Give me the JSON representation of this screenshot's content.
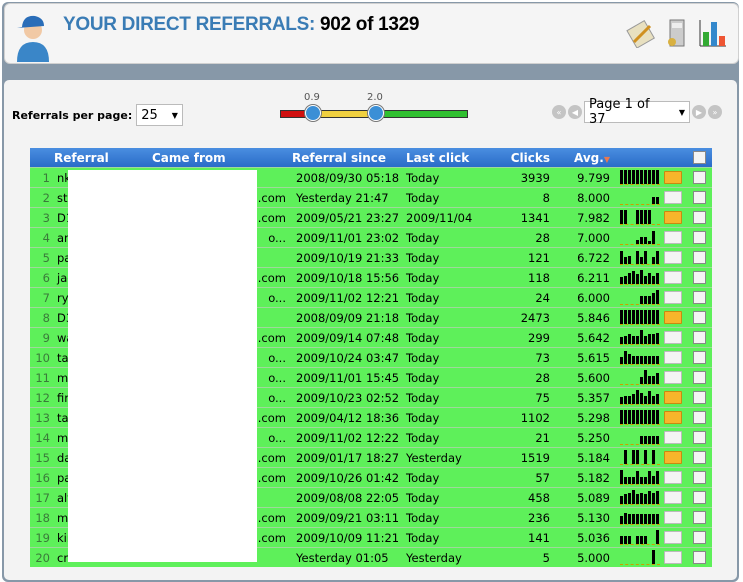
{
  "header": {
    "title_label": "YOUR DIRECT REFERRALS:",
    "title_value": "902 of 1329",
    "icons": [
      "notes-icon",
      "calculator-icon",
      "bar-chart-icon"
    ]
  },
  "controls": {
    "per_page_label": "Referrals per page:",
    "per_page_value": "25",
    "slider_low": "0.9",
    "slider_high": "2.0",
    "slider_min_value": 0.9,
    "slider_max_value": 2.0,
    "page_value": "Page 1 of 37"
  },
  "columns": [
    "Referral",
    "Came from",
    "Referral since",
    "Last click",
    "Clicks",
    "Avg."
  ],
  "colors": {
    "row": "#5ef05a",
    "header": "#2a6cc8",
    "title": "#3a7cb5"
  },
  "rows": [
    {
      "n": "1",
      "ref": "nk",
      "from": "",
      "since": "2008/09/30 05:18",
      "last": "Today",
      "clicks": "3939",
      "avg": "9.799",
      "mail": true,
      "spark": [
        1,
        1,
        1,
        1,
        1,
        1,
        1,
        1,
        1,
        1
      ]
    },
    {
      "n": "2",
      "ref": "ste",
      "from": ".com",
      "since": "Yesterday 21:47",
      "last": "Today",
      "clicks": "8",
      "avg": "8.000",
      "mail": false,
      "spark": [
        0,
        0,
        0,
        0,
        0,
        0,
        0,
        0,
        0.5,
        0.5
      ]
    },
    {
      "n": "3",
      "ref": "D1",
      "from": ".com",
      "since": "2009/05/21 23:27",
      "last": "2009/11/04",
      "clicks": "1341",
      "avg": "7.982",
      "mail": true,
      "spark": [
        1,
        1,
        0,
        0,
        1,
        1,
        1,
        1,
        0,
        0
      ]
    },
    {
      "n": "4",
      "ref": "am",
      "from": "o...",
      "since": "2009/11/01 23:02",
      "last": "Today",
      "clicks": "28",
      "avg": "7.000",
      "mail": false,
      "spark": [
        0,
        0,
        0,
        0,
        0.3,
        0.5,
        0.5,
        0.2,
        0.9,
        0
      ]
    },
    {
      "n": "5",
      "ref": "pa",
      "from": "",
      "since": "2009/10/19 21:33",
      "last": "Today",
      "clicks": "121",
      "avg": "6.722",
      "mail": false,
      "spark": [
        0.9,
        0.5,
        0.6,
        0,
        0.9,
        0.5,
        0.9,
        0,
        0.5,
        0.9
      ]
    },
    {
      "n": "6",
      "ref": "jac",
      "from": ".com",
      "since": "2009/10/18 15:56",
      "last": "Today",
      "clicks": "118",
      "avg": "6.211",
      "mail": false,
      "spark": [
        0.5,
        0.6,
        0.8,
        0.9,
        0.7,
        1,
        0.6,
        0.8,
        0.6,
        0.8
      ]
    },
    {
      "n": "7",
      "ref": "rya",
      "from": "o...",
      "since": "2009/11/02 12:21",
      "last": "Today",
      "clicks": "24",
      "avg": "6.000",
      "mail": false,
      "spark": [
        0,
        0,
        0,
        0,
        0,
        0.6,
        0.6,
        0.6,
        0.8,
        1
      ]
    },
    {
      "n": "8",
      "ref": "D3",
      "from": "",
      "since": "2008/09/09 21:18",
      "last": "Today",
      "clicks": "2473",
      "avg": "5.846",
      "mail": true,
      "spark": [
        1,
        1,
        1,
        1,
        1,
        1,
        1,
        1,
        1,
        1
      ]
    },
    {
      "n": "9",
      "ref": "wa",
      "from": ".com",
      "since": "2009/09/14 07:48",
      "last": "Today",
      "clicks": "299",
      "avg": "5.642",
      "mail": false,
      "spark": [
        0.5,
        0.6,
        0.7,
        0.6,
        0.6,
        1,
        0.6,
        0.7,
        0.7,
        0.8
      ]
    },
    {
      "n": "10",
      "ref": "tay",
      "from": "o...",
      "since": "2009/10/24 03:47",
      "last": "Today",
      "clicks": "73",
      "avg": "5.615",
      "mail": false,
      "spark": [
        0.5,
        0.9,
        0.7,
        0.6,
        0.6,
        0.6,
        0.6,
        0.6,
        0.6,
        0.6
      ]
    },
    {
      "n": "11",
      "ref": "mb",
      "from": "o...",
      "since": "2009/11/01 15:45",
      "last": "Today",
      "clicks": "28",
      "avg": "5.600",
      "mail": false,
      "spark": [
        0,
        0,
        0,
        0,
        0,
        0.5,
        1,
        0.6,
        0.6,
        0.8
      ]
    },
    {
      "n": "12",
      "ref": "firs",
      "from": "o...",
      "since": "2009/10/23 02:52",
      "last": "Today",
      "clicks": "75",
      "avg": "5.357",
      "mail": true,
      "spark": [
        0.5,
        0.6,
        0.6,
        0.7,
        1,
        0.8,
        0.6,
        0.9,
        0.6,
        0.7
      ]
    },
    {
      "n": "13",
      "ref": "tar",
      "from": ".com",
      "since": "2009/04/12 18:36",
      "last": "Today",
      "clicks": "1102",
      "avg": "5.298",
      "mail": true,
      "spark": [
        1,
        1,
        1,
        1,
        1,
        1,
        1,
        1,
        1,
        1
      ]
    },
    {
      "n": "14",
      "ref": "mc",
      "from": "o...",
      "since": "2009/11/02 12:22",
      "last": "Today",
      "clicks": "21",
      "avg": "5.250",
      "mail": false,
      "spark": [
        0,
        0,
        0,
        0,
        0,
        0.6,
        0.6,
        0.6,
        0.6,
        0.6
      ]
    },
    {
      "n": "15",
      "ref": "da",
      "from": ".com",
      "since": "2009/01/17 18:27",
      "last": "Yesterday",
      "clicks": "1519",
      "avg": "5.184",
      "mail": true,
      "spark": [
        0,
        1,
        0,
        1,
        1,
        0,
        1,
        0,
        1,
        0
      ]
    },
    {
      "n": "16",
      "ref": "pa",
      "from": ".com",
      "since": "2009/10/26 01:42",
      "last": "Today",
      "clicks": "57",
      "avg": "5.182",
      "mail": false,
      "spark": [
        1,
        0.5,
        0.5,
        0.5,
        0.9,
        0.5,
        0.5,
        0.9,
        0.6,
        0.9
      ]
    },
    {
      "n": "17",
      "ref": "alf",
      "from": "",
      "since": "2009/08/08 22:05",
      "last": "Today",
      "clicks": "458",
      "avg": "5.089",
      "mail": false,
      "spark": [
        0.6,
        0.7,
        0.8,
        1,
        0.7,
        0.8,
        0.7,
        0.9,
        0.8,
        0.9
      ]
    },
    {
      "n": "18",
      "ref": "ma",
      "from": ".com",
      "since": "2009/09/21 03:11",
      "last": "Today",
      "clicks": "236",
      "avg": "5.130",
      "mail": false,
      "spark": [
        0.6,
        0.8,
        0.7,
        0.7,
        0.7,
        0.7,
        0.7,
        0.7,
        0.7,
        0.7
      ]
    },
    {
      "n": "19",
      "ref": "kir",
      "from": ".com",
      "since": "2009/10/09 11:21",
      "last": "Today",
      "clicks": "141",
      "avg": "5.036",
      "mail": false,
      "spark": [
        0.6,
        0.6,
        0.6,
        0,
        0.6,
        0.6,
        0.6,
        0,
        0,
        1
      ]
    },
    {
      "n": "20",
      "ref": "cra",
      "from": "",
      "since": "Yesterday 01:05",
      "last": "Yesterday",
      "clicks": "5",
      "avg": "5.000",
      "mail": false,
      "spark": [
        0,
        0,
        0,
        0,
        0,
        0,
        0,
        0,
        1,
        0
      ]
    }
  ]
}
